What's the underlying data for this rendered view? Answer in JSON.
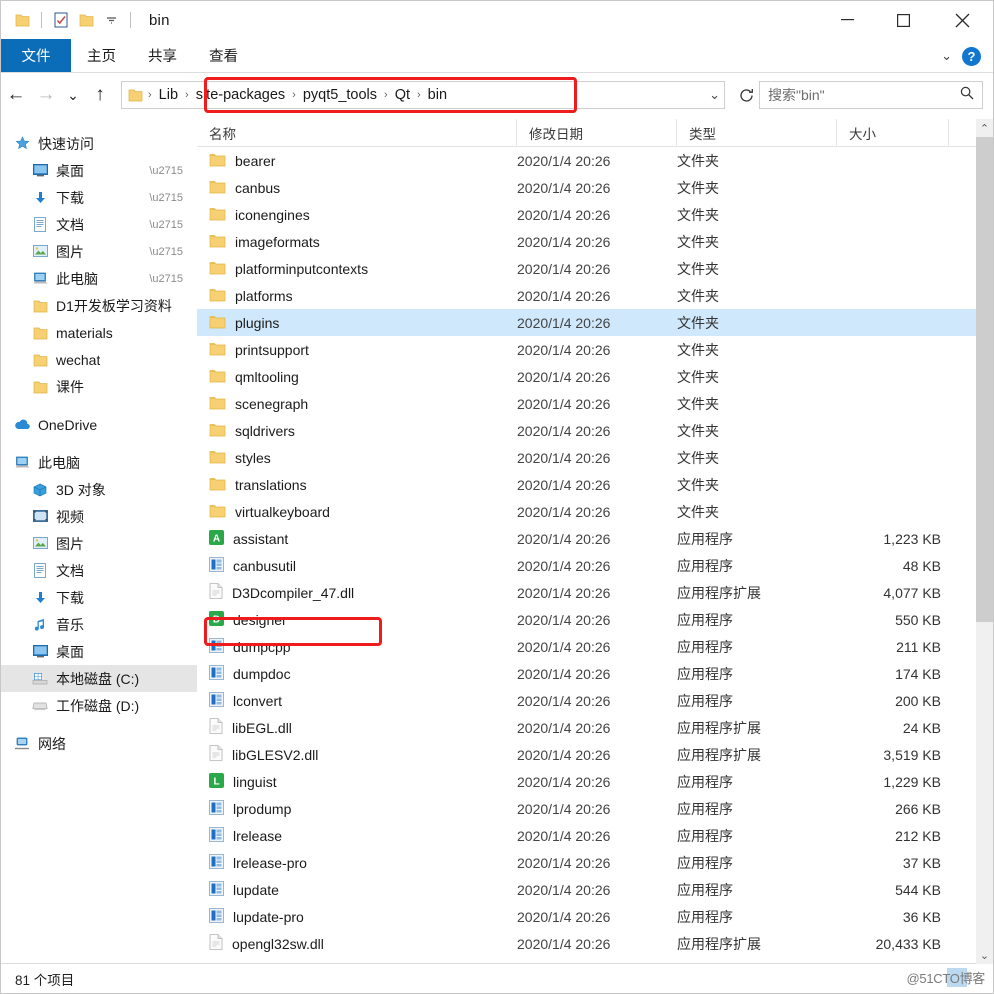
{
  "window": {
    "title": "bin",
    "quick_access_icons": [
      "folder-icon",
      "properties-icon",
      "new-folder-icon",
      "chevron-down-icon"
    ],
    "controls": {
      "minimize": "—",
      "maximize": "□",
      "close": "✕"
    }
  },
  "ribbon": {
    "tabs": [
      {
        "label": "文件",
        "active": true
      },
      {
        "label": "主页",
        "active": false
      },
      {
        "label": "共享",
        "active": false
      },
      {
        "label": "查看",
        "active": false
      }
    ],
    "collapse_label": "⌄",
    "help_label": "?"
  },
  "addressbar": {
    "back": "←",
    "forward": "→",
    "recent": "⌄",
    "up": "↑",
    "breadcrumbs": [
      "Lib",
      "site-packages",
      "pyqt5_tools",
      "Qt",
      "bin"
    ],
    "separator": "›",
    "dropdown": "⌄",
    "refresh": "↻",
    "search_placeholder": "搜索\"bin\"",
    "search_value": ""
  },
  "sidebar": {
    "groups": [
      {
        "header": {
          "label": "快速访问",
          "icon": "star-icon"
        },
        "items": [
          {
            "label": "桌面",
            "icon": "desktop-icon",
            "pinned": true
          },
          {
            "label": "下载",
            "icon": "download-icon",
            "pinned": true
          },
          {
            "label": "文档",
            "icon": "documents-icon",
            "pinned": true
          },
          {
            "label": "图片",
            "icon": "pictures-icon",
            "pinned": true
          },
          {
            "label": "此电脑",
            "icon": "this-pc-icon",
            "pinned": true
          },
          {
            "label": "D1开发板学习资料",
            "icon": "folder-icon",
            "pinned": false
          },
          {
            "label": "materials",
            "icon": "folder-icon",
            "pinned": false
          },
          {
            "label": "wechat",
            "icon": "folder-icon",
            "pinned": false
          },
          {
            "label": "课件",
            "icon": "folder-icon",
            "pinned": false
          }
        ]
      },
      {
        "header": {
          "label": "OneDrive",
          "icon": "onedrive-icon"
        },
        "items": []
      },
      {
        "header": {
          "label": "此电脑",
          "icon": "this-pc-icon"
        },
        "items": [
          {
            "label": "3D 对象",
            "icon": "3d-objects-icon",
            "selected": false
          },
          {
            "label": "视频",
            "icon": "videos-icon",
            "selected": false
          },
          {
            "label": "图片",
            "icon": "pictures-icon",
            "selected": false
          },
          {
            "label": "文档",
            "icon": "documents-icon",
            "selected": false
          },
          {
            "label": "下载",
            "icon": "download-icon",
            "selected": false
          },
          {
            "label": "音乐",
            "icon": "music-icon",
            "selected": false
          },
          {
            "label": "桌面",
            "icon": "desktop-icon",
            "selected": false
          },
          {
            "label": "本地磁盘 (C:)",
            "icon": "local-disk-icon",
            "selected": true
          },
          {
            "label": "工作磁盘 (D:)",
            "icon": "disk-icon",
            "selected": false
          }
        ]
      },
      {
        "header": {
          "label": "网络",
          "icon": "network-icon"
        },
        "items": []
      }
    ]
  },
  "filelist": {
    "columns": [
      {
        "key": "name",
        "label": "名称",
        "sorted": true,
        "sort_dir": "asc"
      },
      {
        "key": "date",
        "label": "修改日期"
      },
      {
        "key": "type",
        "label": "类型"
      },
      {
        "key": "size",
        "label": "大小"
      }
    ],
    "sort_caret": "⌃",
    "rows": [
      {
        "name": "bearer",
        "date": "2020/1/4 20:26",
        "type": "文件夹",
        "size": "",
        "icon": "folder-icon",
        "selected": false
      },
      {
        "name": "canbus",
        "date": "2020/1/4 20:26",
        "type": "文件夹",
        "size": "",
        "icon": "folder-icon",
        "selected": false
      },
      {
        "name": "iconengines",
        "date": "2020/1/4 20:26",
        "type": "文件夹",
        "size": "",
        "icon": "folder-icon",
        "selected": false
      },
      {
        "name": "imageformats",
        "date": "2020/1/4 20:26",
        "type": "文件夹",
        "size": "",
        "icon": "folder-icon",
        "selected": false
      },
      {
        "name": "platforminputcontexts",
        "date": "2020/1/4 20:26",
        "type": "文件夹",
        "size": "",
        "icon": "folder-icon",
        "selected": false
      },
      {
        "name": "platforms",
        "date": "2020/1/4 20:26",
        "type": "文件夹",
        "size": "",
        "icon": "folder-icon",
        "selected": false
      },
      {
        "name": "plugins",
        "date": "2020/1/4 20:26",
        "type": "文件夹",
        "size": "",
        "icon": "folder-icon",
        "selected": true
      },
      {
        "name": "printsupport",
        "date": "2020/1/4 20:26",
        "type": "文件夹",
        "size": "",
        "icon": "folder-icon",
        "selected": false
      },
      {
        "name": "qmltooling",
        "date": "2020/1/4 20:26",
        "type": "文件夹",
        "size": "",
        "icon": "folder-icon",
        "selected": false
      },
      {
        "name": "scenegraph",
        "date": "2020/1/4 20:26",
        "type": "文件夹",
        "size": "",
        "icon": "folder-icon",
        "selected": false
      },
      {
        "name": "sqldrivers",
        "date": "2020/1/4 20:26",
        "type": "文件夹",
        "size": "",
        "icon": "folder-icon",
        "selected": false
      },
      {
        "name": "styles",
        "date": "2020/1/4 20:26",
        "type": "文件夹",
        "size": "",
        "icon": "folder-icon",
        "selected": false
      },
      {
        "name": "translations",
        "date": "2020/1/4 20:26",
        "type": "文件夹",
        "size": "",
        "icon": "folder-icon",
        "selected": false
      },
      {
        "name": "virtualkeyboard",
        "date": "2020/1/4 20:26",
        "type": "文件夹",
        "size": "",
        "icon": "folder-icon",
        "selected": false
      },
      {
        "name": "assistant",
        "date": "2020/1/4 20:26",
        "type": "应用程序",
        "size": "1,223 KB",
        "icon": "assistant-app-icon",
        "selected": false
      },
      {
        "name": "canbusutil",
        "date": "2020/1/4 20:26",
        "type": "应用程序",
        "size": "48 KB",
        "icon": "app-icon",
        "selected": false
      },
      {
        "name": "D3Dcompiler_47.dll",
        "date": "2020/1/4 20:26",
        "type": "应用程序扩展",
        "size": "4,077 KB",
        "icon": "dll-icon",
        "selected": false
      },
      {
        "name": "designer",
        "date": "2020/1/4 20:26",
        "type": "应用程序",
        "size": "550 KB",
        "icon": "designer-app-icon",
        "selected": false,
        "annotated": true
      },
      {
        "name": "dumpcpp",
        "date": "2020/1/4 20:26",
        "type": "应用程序",
        "size": "211 KB",
        "icon": "app-icon",
        "selected": false
      },
      {
        "name": "dumpdoc",
        "date": "2020/1/4 20:26",
        "type": "应用程序",
        "size": "174 KB",
        "icon": "app-icon",
        "selected": false
      },
      {
        "name": "lconvert",
        "date": "2020/1/4 20:26",
        "type": "应用程序",
        "size": "200 KB",
        "icon": "app-icon",
        "selected": false
      },
      {
        "name": "libEGL.dll",
        "date": "2020/1/4 20:26",
        "type": "应用程序扩展",
        "size": "24 KB",
        "icon": "dll-icon",
        "selected": false
      },
      {
        "name": "libGLESV2.dll",
        "date": "2020/1/4 20:26",
        "type": "应用程序扩展",
        "size": "3,519 KB",
        "icon": "dll-icon",
        "selected": false
      },
      {
        "name": "linguist",
        "date": "2020/1/4 20:26",
        "type": "应用程序",
        "size": "1,229 KB",
        "icon": "linguist-app-icon",
        "selected": false
      },
      {
        "name": "lprodump",
        "date": "2020/1/4 20:26",
        "type": "应用程序",
        "size": "266 KB",
        "icon": "app-icon",
        "selected": false
      },
      {
        "name": "lrelease",
        "date": "2020/1/4 20:26",
        "type": "应用程序",
        "size": "212 KB",
        "icon": "app-icon",
        "selected": false
      },
      {
        "name": "lrelease-pro",
        "date": "2020/1/4 20:26",
        "type": "应用程序",
        "size": "37 KB",
        "icon": "app-icon",
        "selected": false
      },
      {
        "name": "lupdate",
        "date": "2020/1/4 20:26",
        "type": "应用程序",
        "size": "544 KB",
        "icon": "app-icon",
        "selected": false
      },
      {
        "name": "lupdate-pro",
        "date": "2020/1/4 20:26",
        "type": "应用程序",
        "size": "36 KB",
        "icon": "app-icon",
        "selected": false
      },
      {
        "name": "opengl32sw.dll",
        "date": "2020/1/4 20:26",
        "type": "应用程序扩展",
        "size": "20,433 KB",
        "icon": "dll-icon",
        "selected": false
      }
    ]
  },
  "scrollbar": {
    "up": "⌃",
    "down": "⌄"
  },
  "statusbar": {
    "item_count": "81 个项目"
  },
  "watermark": {
    "text": "@51CTO博客"
  },
  "colors": {
    "accent": "#0b6cb8",
    "selection": "#cfe8fb",
    "nav_selection": "#e5e5e5",
    "annotation": "#ee1c1c",
    "folder": "#f6d072"
  }
}
